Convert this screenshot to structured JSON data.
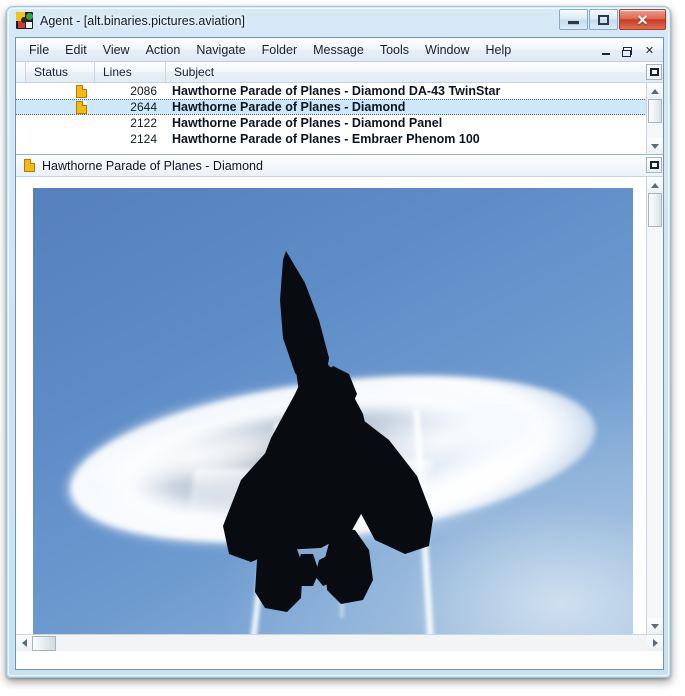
{
  "window": {
    "title": "Agent - [alt.binaries.pictures.aviation]",
    "app_icon": "agent-app-icon",
    "caption": {
      "minimize": "minimize-icon",
      "maximize": "maximize-icon",
      "close": "✕"
    }
  },
  "menubar": {
    "items": [
      {
        "label": "File"
      },
      {
        "label": "Edit"
      },
      {
        "label": "View"
      },
      {
        "label": "Action"
      },
      {
        "label": "Navigate"
      },
      {
        "label": "Folder"
      },
      {
        "label": "Message"
      },
      {
        "label": "Tools"
      },
      {
        "label": "Window"
      },
      {
        "label": "Help"
      }
    ],
    "mdi": {
      "minimize": "mdi-minimize-icon",
      "restore": "mdi-restore-icon",
      "close": "✕"
    }
  },
  "messagelist": {
    "columns": [
      {
        "label": "Status"
      },
      {
        "label": "Lines"
      },
      {
        "label": "Subject"
      }
    ],
    "rows": [
      {
        "status_icon": "attachment-document-icon",
        "has_icon": true,
        "lines": "2086",
        "subject": "Hawthorne Parade of Planes - Diamond DA-43 TwinStar",
        "selected": false
      },
      {
        "status_icon": "attachment-document-icon",
        "has_icon": true,
        "lines": "2644",
        "subject": "Hawthorne Parade of Planes - Diamond",
        "selected": true
      },
      {
        "status_icon": "",
        "has_icon": false,
        "lines": "2122",
        "subject": "Hawthorne Parade of Planes - Diamond Panel",
        "selected": false
      },
      {
        "status_icon": "",
        "has_icon": false,
        "lines": "2124",
        "subject": "Hawthorne Parade of Planes - Embraer Phenom 100",
        "selected": false
      }
    ]
  },
  "preview": {
    "icon": "document-icon",
    "title": "Hawthorne Parade of Planes - Diamond",
    "image_alt": "fighter-jet-vapor-cone-photo"
  },
  "colors": {
    "accent": "#cfe8f9",
    "frame": "#9dc4e0",
    "title_text": "#0c1828",
    "close_button": "#c83a22",
    "doc_icon": "#f5b814",
    "sky_top": "#5580bd",
    "sky_bottom": "#a9c6e4",
    "jet": "#0a0d12"
  }
}
